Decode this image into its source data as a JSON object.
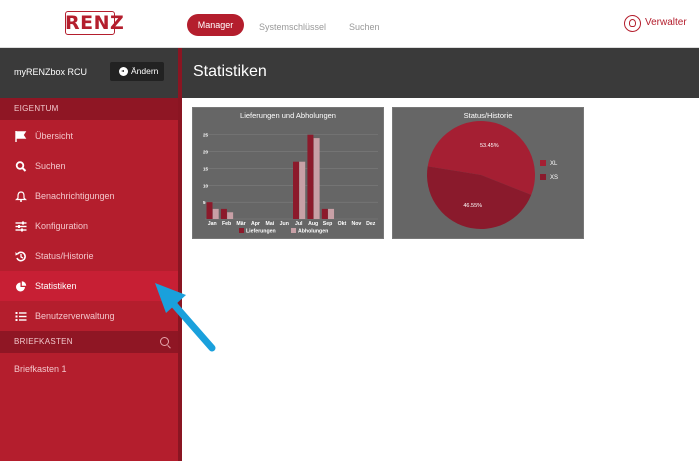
{
  "header": {
    "logo_text": "RENZ",
    "tabs": [
      {
        "label": "Manager"
      },
      {
        "label": "Systemschlüssel"
      },
      {
        "label": "Suchen"
      }
    ],
    "user_label": "Verwalter"
  },
  "sidebar": {
    "box_title": "myRENZbox RCU",
    "change_button": "Ändern",
    "section_property": "EIGENTUM",
    "items": [
      {
        "label": "Übersicht",
        "icon": "flag-icon"
      },
      {
        "label": "Suchen",
        "icon": "search-icon"
      },
      {
        "label": "Benachrichtigungen",
        "icon": "bell-icon"
      },
      {
        "label": "Konfiguration",
        "icon": "sliders-icon"
      },
      {
        "label": "Status/Historie",
        "icon": "history-icon"
      },
      {
        "label": "Statistiken",
        "icon": "pie-chart-icon"
      },
      {
        "label": "Benutzerverwaltung",
        "icon": "list-icon"
      }
    ],
    "active_item": "Statistiken",
    "section_mailbox": "BRIEFKASTEN",
    "mailboxes": [
      "Briefkasten 1"
    ]
  },
  "main": {
    "title": "Statistiken"
  },
  "colors": {
    "brand": "#b41e2d",
    "series_deliveries": "#8c1a2b",
    "series_pickups": "#c8a0a6",
    "pie_xl": "#a51f33",
    "pie_xs": "#8a1a2c",
    "arrow": "#1aa0dc"
  },
  "chart_data": [
    {
      "type": "bar",
      "title": "Lieferungen und Abholungen",
      "categories": [
        "Jan",
        "Feb",
        "Mär",
        "Apr",
        "Mai",
        "Jun",
        "Jul",
        "Aug",
        "Sep",
        "Okt",
        "Nov",
        "Dez"
      ],
      "series": [
        {
          "name": "Lieferungen",
          "values": [
            5,
            3,
            0,
            0,
            0,
            0,
            17,
            25,
            3,
            0,
            0,
            0
          ]
        },
        {
          "name": "Abholungen",
          "values": [
            3,
            2,
            0,
            0,
            0,
            0,
            17,
            24,
            3,
            0,
            0,
            0
          ]
        }
      ],
      "yticks": [
        0,
        5,
        10,
        15,
        20,
        25
      ],
      "ylim": [
        0,
        27
      ],
      "legend": "bottom"
    },
    {
      "type": "pie",
      "title": "Status/Historie",
      "slices": [
        {
          "name": "XL",
          "value": 53.45,
          "label": "53.45%"
        },
        {
          "name": "XS",
          "value": 46.55,
          "label": "46.55%"
        }
      ],
      "legend": "right"
    }
  ]
}
